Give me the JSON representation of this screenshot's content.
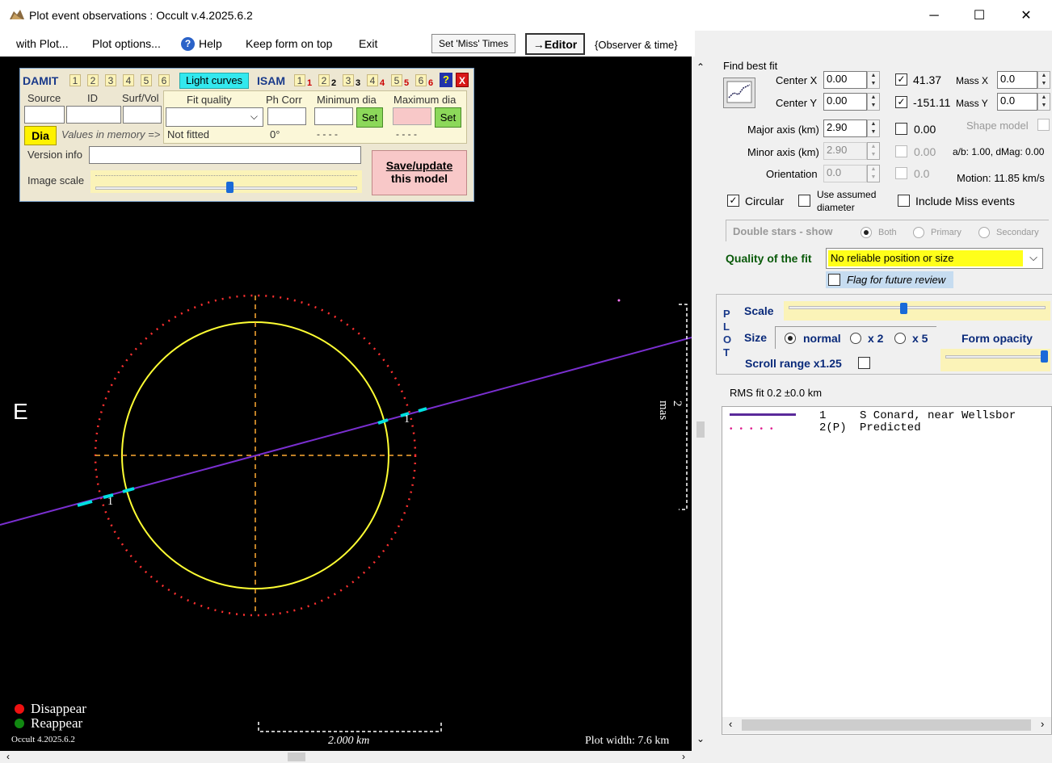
{
  "window": {
    "title": "Plot event observations : Occult v.4.2025.6.2",
    "minimize": "─",
    "maximize": "☐",
    "close": "✕"
  },
  "menu": {
    "with_plot": "with Plot...",
    "plot_options": "Plot options...",
    "help": "Help",
    "keep_on_top": "Keep form on top",
    "exit": "Exit",
    "set_miss_times": "Set 'Miss' Times",
    "editor": "→Editor",
    "observer_time": "{Observer & time}"
  },
  "damit_panel": {
    "damit_label": "DAMIT",
    "damit_numbers": [
      "1",
      "2",
      "3",
      "4",
      "5",
      "6"
    ],
    "light_curves": "Light curves",
    "isam_label": "ISAM",
    "isam_numbers": [
      "1",
      "1",
      "2",
      "2",
      "3",
      "3",
      "4",
      "4",
      "5",
      "5",
      "6",
      "6"
    ],
    "help_btn": "?",
    "close_btn": "X",
    "source": "Source",
    "id": "ID",
    "surf_vol": "Surf/Vol",
    "fit_quality": "Fit quality",
    "ph_corr": "Ph Corr",
    "minimum_dia": "Minimum dia",
    "maximum_dia": "Maximum dia",
    "set1": "Set",
    "set2": "Set",
    "dia": "Dia",
    "values_in_memory": "Values in memory =>",
    "not_fitted": "Not fitted",
    "ph_value": "0°",
    "min_dash": "- - - -",
    "max_dash": "- - - -",
    "version_info": "Version info",
    "image_scale": "Image scale",
    "save_update": "Save/update",
    "this_model": "this model"
  },
  "plot": {
    "east_label": "E",
    "scale_label": "2 mas",
    "chord_num_right": "1",
    "chord_num_left": "1",
    "disappear": "Disappear",
    "reappear": "Reappear",
    "version": "Occult 4.2025.6.2",
    "scale_km": "2.000 km",
    "plot_width": "Plot width: 7.6 km",
    "colors": {
      "ellipse": "#ffff33",
      "predicted": "#ff3030",
      "chord": "#7a2fd0",
      "event": "#00e0e0",
      "axes": "#ffaa33"
    }
  },
  "fit": {
    "find_best_fit": "Find best fit",
    "center_x_label": "Center X",
    "center_x": "0.00",
    "center_y_label": "Center Y",
    "center_y": "0.00",
    "cx_check": "41.37",
    "cy_check": "-151.11",
    "mass_x_label": "Mass X",
    "mass_x": "0.0",
    "mass_y_label": "Mass Y",
    "mass_y": "0.0",
    "major_label": "Major axis (km)",
    "major": "2.90",
    "major_check": "0.00",
    "minor_label": "Minor axis (km)",
    "minor": "2.90",
    "minor_check": "0.00",
    "orient_label": "Orientation",
    "orient": "0.0",
    "orient_check": "0.0",
    "shape_model": "Shape model",
    "ab_dmag": "a/b: 1.00, dMag: 0.00",
    "motion": "Motion: 11.85 km/s",
    "circular": "Circular",
    "use_assumed_1": "Use assumed",
    "use_assumed_2": "diameter",
    "include_miss": "Include Miss events",
    "double_stars": "Double stars - show",
    "both": "Both",
    "primary": "Primary",
    "secondary": "Secondary",
    "quality_label": "Quality of the fit",
    "quality_value": "No reliable position or size",
    "flag_review": "Flag for future review"
  },
  "plot_panel": {
    "plot_letters": [
      "P",
      "L",
      "O",
      "T"
    ],
    "scale": "Scale",
    "size": "Size",
    "normal": "normal",
    "x2": "x 2",
    "x5": "x 5",
    "form_opacity": "Form opacity",
    "scroll_range": "Scroll range x1.25"
  },
  "rms": "RMS fit 0.2 ±0.0 km",
  "legend": [
    {
      "num": "1",
      "name": "S Conard, near Wellsbor"
    },
    {
      "num": "2(P)",
      "name": "Predicted"
    }
  ]
}
